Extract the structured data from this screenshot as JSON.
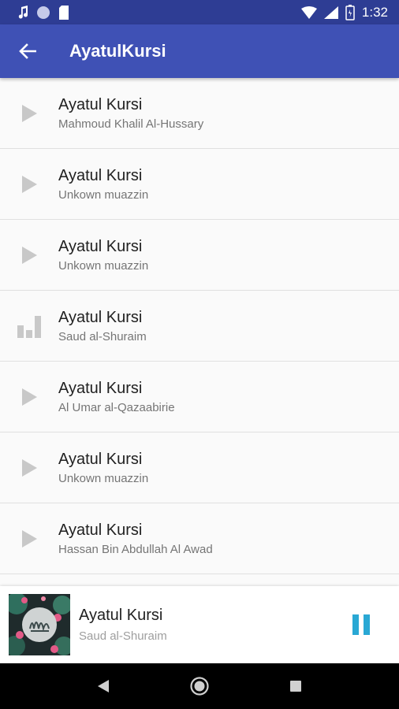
{
  "status_bar": {
    "time": "1:32",
    "left_icons": [
      "music-note-icon",
      "circle-icon",
      "sd-card-icon"
    ],
    "right_icons": [
      "wifi-icon",
      "signal-icon",
      "battery-icon"
    ]
  },
  "app_bar": {
    "title": "AyatulKursi",
    "back_icon": "arrow-left-icon",
    "color": "#3f51b5",
    "status_color": "#2e3d94"
  },
  "tracks": [
    {
      "title": "Ayatul Kursi",
      "reciter": "Mahmoud Khalil Al-Hussary",
      "state": "play"
    },
    {
      "title": "Ayatul Kursi",
      "reciter": "Unkown muazzin",
      "state": "play"
    },
    {
      "title": "Ayatul Kursi",
      "reciter": "Unkown muazzin",
      "state": "play"
    },
    {
      "title": "Ayatul Kursi",
      "reciter": "Saud al-Shuraim",
      "state": "playing"
    },
    {
      "title": "Ayatul Kursi",
      "reciter": "Al Umar al-Qazaabirie",
      "state": "play"
    },
    {
      "title": "Ayatul Kursi",
      "reciter": "Unkown muazzin",
      "state": "play"
    },
    {
      "title": "Ayatul Kursi",
      "reciter": "Hassan Bin Abdullah Al Awad",
      "state": "play"
    }
  ],
  "now_playing": {
    "title": "Ayatul Kursi",
    "reciter": "Saud al-Shuraim",
    "control_icon": "pause-icon",
    "accent": "#29a8d4"
  },
  "nav_bar": {
    "icons": [
      "back-triangle-icon",
      "home-circle-icon",
      "recents-square-icon"
    ]
  }
}
